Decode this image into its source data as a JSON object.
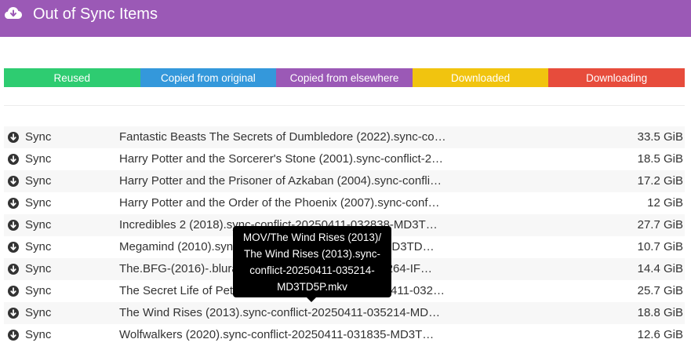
{
  "header": {
    "title": "Out of Sync Items",
    "icon": "cloud-download-icon",
    "background": "#9b59b6"
  },
  "legend": [
    {
      "label": "Reused",
      "color": "#2ecc71"
    },
    {
      "label": "Copied from original",
      "color": "#3498db"
    },
    {
      "label": "Copied from elsewhere",
      "color": "#9b59b6"
    },
    {
      "label": "Downloaded",
      "color": "#f1c40f"
    },
    {
      "label": "Downloading",
      "color": "#e74c3c"
    }
  ],
  "rows": [
    {
      "action": "Sync",
      "file": "Fantastic Beasts The Secrets of Dumbledore (2022).sync-co…",
      "size": "33.5 GiB"
    },
    {
      "action": "Sync",
      "file": "Harry Potter and the Sorcerer's Stone (2001).sync-conflict-2…",
      "size": "18.5 GiB"
    },
    {
      "action": "Sync",
      "file": "Harry Potter and the Prisoner of Azkaban (2004).sync-confli…",
      "size": "17.2 GiB"
    },
    {
      "action": "Sync",
      "file": "Harry Potter and the Order of the Phoenix (2007).sync-conf…",
      "size": "12 GiB"
    },
    {
      "action": "Sync",
      "file": "Incredibles 2 (2018).sync-conflict-20250411-032838-MD3T…",
      "size": "27.7 GiB"
    },
    {
      "action": "Sync",
      "file": "Megamind (2010).sync-conflict-20250411-033141-MD3TD…",
      "size": "10.7 GiB"
    },
    {
      "action": "Sync",
      "file": "The.BFG-(2016)-.bluray.1080p.sync-conflict-2021.x264-IF…",
      "size": "14.4 GiB"
    },
    {
      "action": "Sync",
      "file": "The Secret Life of Pets 2 (2019).sync-conflict-20250411-032…",
      "size": "25.7 GiB"
    },
    {
      "action": "Sync",
      "file": "The Wind Rises (2013).sync-conflict-20250411-035214-MD…",
      "size": "18.8 GiB"
    },
    {
      "action": "Sync",
      "file": "Wolfwalkers (2020).sync-conflict-20250411-031835-MD3T…",
      "size": "12.6 GiB"
    }
  ],
  "tooltip": {
    "lines": [
      "MOV/The Wind Rises (2013)/",
      "The Wind Rises (2013).sync-",
      "conflict-20250411-035214-",
      "MD3TD5P.mkv"
    ]
  },
  "row_icon": "circle-arrow-down-icon"
}
